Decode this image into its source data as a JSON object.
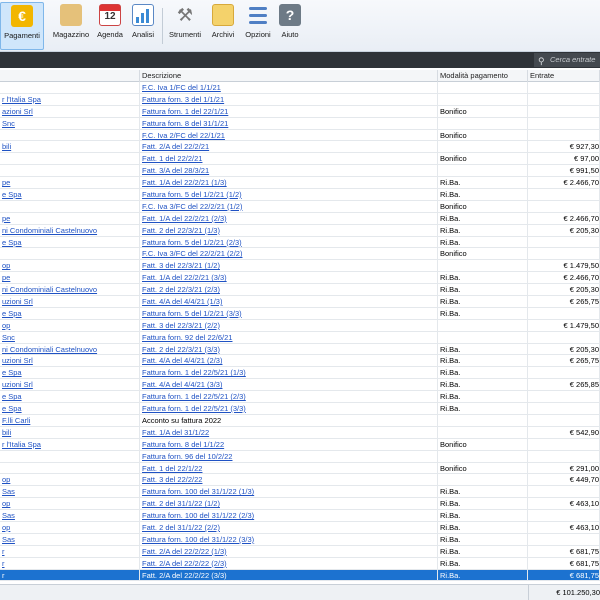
{
  "toolbar": {
    "pagamenti": "Pagamenti",
    "magazzino": "Magazzino",
    "agenda": "Agenda",
    "agenda_day": "12",
    "analisi": "Analisi",
    "strumenti": "Strumenti",
    "archivi": "Archivi",
    "opzioni": "Opzioni",
    "aiuto": "Aiuto"
  },
  "search": {
    "placeholder": "Cerca entrate"
  },
  "table": {
    "headers": {
      "descrizione": "Descrizione",
      "modalita": "Modalità pagamento",
      "entrate": "Entrate"
    },
    "rows": [
      {
        "cliente": "",
        "descrizione": "F.C. Iva 1/FC del 1/1/21",
        "modalita": "",
        "entrate": ""
      },
      {
        "cliente": "r l'Italia Spa",
        "descrizione": "Fattura forn. 3 del 1/1/21",
        "modalita": "",
        "entrate": ""
      },
      {
        "cliente": "azioni Srl",
        "descrizione": "Fattura forn. 1 del 22/1/21",
        "modalita": "Bonifico",
        "entrate": ""
      },
      {
        "cliente": "Snc",
        "descrizione": "Fattura forn. 8 del 31/1/21",
        "modalita": "",
        "entrate": ""
      },
      {
        "cliente": "",
        "descrizione": "F.C. Iva 2/FC del 22/1/21",
        "modalita": "Bonifico",
        "entrate": ""
      },
      {
        "cliente": "bili",
        "descrizione": "Fatt. 2/A del 22/2/21",
        "modalita": "",
        "entrate": "€ 927,30"
      },
      {
        "cliente": "",
        "descrizione": "Fatt. 1 del 22/2/21",
        "modalita": "Bonifico",
        "entrate": "€ 97,00"
      },
      {
        "cliente": "",
        "descrizione": "Fatt. 3/A del 28/3/21",
        "modalita": "",
        "entrate": "€ 991,50"
      },
      {
        "cliente": "pe",
        "descrizione": "Fatt. 1/A del 22/2/21  (1/3)",
        "modalita": "Ri.Ba.",
        "entrate": "€ 2.466,70"
      },
      {
        "cliente": "e Spa",
        "descrizione": "Fattura forn. 5 del 1/2/21  (1/2)",
        "modalita": "Ri.Ba.",
        "entrate": ""
      },
      {
        "cliente": "",
        "descrizione": "F.C. Iva 3/FC del 22/2/21  (1/2)",
        "modalita": "Bonifico",
        "entrate": ""
      },
      {
        "cliente": "pe",
        "descrizione": "Fatt. 1/A del 22/2/21  (2/3)",
        "modalita": "Ri.Ba.",
        "entrate": "€ 2.466,70"
      },
      {
        "cliente": "ni Condominiali Castelnuovo",
        "descrizione": "Fatt. 2 del 22/3/21  (1/3)",
        "modalita": "Ri.Ba.",
        "entrate": "€ 205,30"
      },
      {
        "cliente": "e Spa",
        "descrizione": "Fattura forn. 5 del 1/2/21  (2/3)",
        "modalita": "Ri.Ba.",
        "entrate": ""
      },
      {
        "cliente": "",
        "descrizione": "F.C. Iva 3/FC del 22/2/21  (2/2)",
        "modalita": "Bonifico",
        "entrate": ""
      },
      {
        "cliente": "op",
        "descrizione": "Fatt. 3 del 22/3/21  (1/2)",
        "modalita": "",
        "entrate": "€ 1.479,50"
      },
      {
        "cliente": "pe",
        "descrizione": "Fatt. 1/A del 22/2/21  (3/3)",
        "modalita": "Ri.Ba.",
        "entrate": "€ 2.466,70"
      },
      {
        "cliente": "ni Condominiali Castelnuovo",
        "descrizione": "Fatt. 2 del 22/3/21  (2/3)",
        "modalita": "Ri.Ba.",
        "entrate": "€ 205,30"
      },
      {
        "cliente": "uzioni Srl",
        "descrizione": "Fatt. 4/A del 4/4/21  (1/3)",
        "modalita": "Ri.Ba.",
        "entrate": "€ 265,75"
      },
      {
        "cliente": "e Spa",
        "descrizione": "Fattura forn. 5 del 1/2/21  (3/3)",
        "modalita": "Ri.Ba.",
        "entrate": ""
      },
      {
        "cliente": "op",
        "descrizione": "Fatt. 3 del 22/3/21  (2/2)",
        "modalita": "",
        "entrate": "€ 1.479,50"
      },
      {
        "cliente": "Snc",
        "descrizione": "Fattura forn. 92 del 22/6/21",
        "modalita": "",
        "entrate": ""
      },
      {
        "cliente": "ni Condominiali Castelnuovo",
        "descrizione": "Fatt. 2 del 22/3/21  (3/3)",
        "modalita": "Ri.Ba.",
        "entrate": "€ 205,30"
      },
      {
        "cliente": "uzioni Srl",
        "descrizione": "Fatt. 4/A del 4/4/21  (2/3)",
        "modalita": "Ri.Ba.",
        "entrate": "€ 265,75"
      },
      {
        "cliente": "e Spa",
        "descrizione": "Fattura forn. 1 del 22/5/21  (1/3)",
        "modalita": "Ri.Ba.",
        "entrate": ""
      },
      {
        "cliente": "uzioni Srl",
        "descrizione": "Fatt. 4/A del 4/4/21  (3/3)",
        "modalita": "Ri.Ba.",
        "entrate": "€ 265,85"
      },
      {
        "cliente": "e Spa",
        "descrizione": "Fattura forn. 1 del 22/5/21  (2/3)",
        "modalita": "Ri.Ba.",
        "entrate": ""
      },
      {
        "cliente": "e Spa",
        "descrizione": "Fattura forn. 1 del 22/5/21  (3/3)",
        "modalita": "Ri.Ba.",
        "entrate": ""
      },
      {
        "cliente": "F.lli Carli",
        "descrizione": "Acconto su fattura 2022",
        "modalita": "",
        "entrate": ""
      },
      {
        "cliente": "bili",
        "descrizione": "Fatt. 1/A del 31/1/22",
        "modalita": "",
        "entrate": "€ 542,90"
      },
      {
        "cliente": "r l'Italia Spa",
        "descrizione": "Fattura forn. 8 del 1/1/22",
        "modalita": "Bonifico",
        "entrate": ""
      },
      {
        "cliente": "",
        "descrizione": "Fattura forn. 96 del 10/2/22",
        "modalita": "",
        "entrate": ""
      },
      {
        "cliente": "",
        "descrizione": "Fatt. 1 del 22/1/22",
        "modalita": "Bonifico",
        "entrate": "€ 291,00"
      },
      {
        "cliente": "op",
        "descrizione": "Fatt. 3 del 22/2/22",
        "modalita": "",
        "entrate": "€ 449,70"
      },
      {
        "cliente": "Sas",
        "descrizione": "Fattura forn. 100 del 31/1/22  (1/3)",
        "modalita": "Ri.Ba.",
        "entrate": ""
      },
      {
        "cliente": "op",
        "descrizione": "Fatt. 2 del 31/1/22  (1/2)",
        "modalita": "Ri.Ba.",
        "entrate": "€ 463,10"
      },
      {
        "cliente": "Sas",
        "descrizione": "Fattura forn. 100 del 31/1/22  (2/3)",
        "modalita": "Ri.Ba.",
        "entrate": ""
      },
      {
        "cliente": "op",
        "descrizione": "Fatt. 2 del 31/1/22  (2/2)",
        "modalita": "Ri.Ba.",
        "entrate": "€ 463,10"
      },
      {
        "cliente": "Sas",
        "descrizione": "Fattura forn. 100 del 31/1/22  (3/3)",
        "modalita": "Ri.Ba.",
        "entrate": ""
      },
      {
        "cliente": "r",
        "descrizione": "Fatt. 2/A del 22/2/22  (1/3)",
        "modalita": "Ri.Ba.",
        "entrate": "€ 681,75"
      },
      {
        "cliente": "r",
        "descrizione": "Fatt. 2/A del 22/2/22  (2/3)",
        "modalita": "Ri.Ba.",
        "entrate": "€ 681,75"
      },
      {
        "cliente": "r",
        "descrizione": "Fatt. 2/A del 22/2/22  (3/3)",
        "modalita": "Ri.Ba.",
        "entrate": "€ 681,75",
        "selected": true
      }
    ]
  },
  "footer": {
    "total": "€ 101.250,30"
  }
}
